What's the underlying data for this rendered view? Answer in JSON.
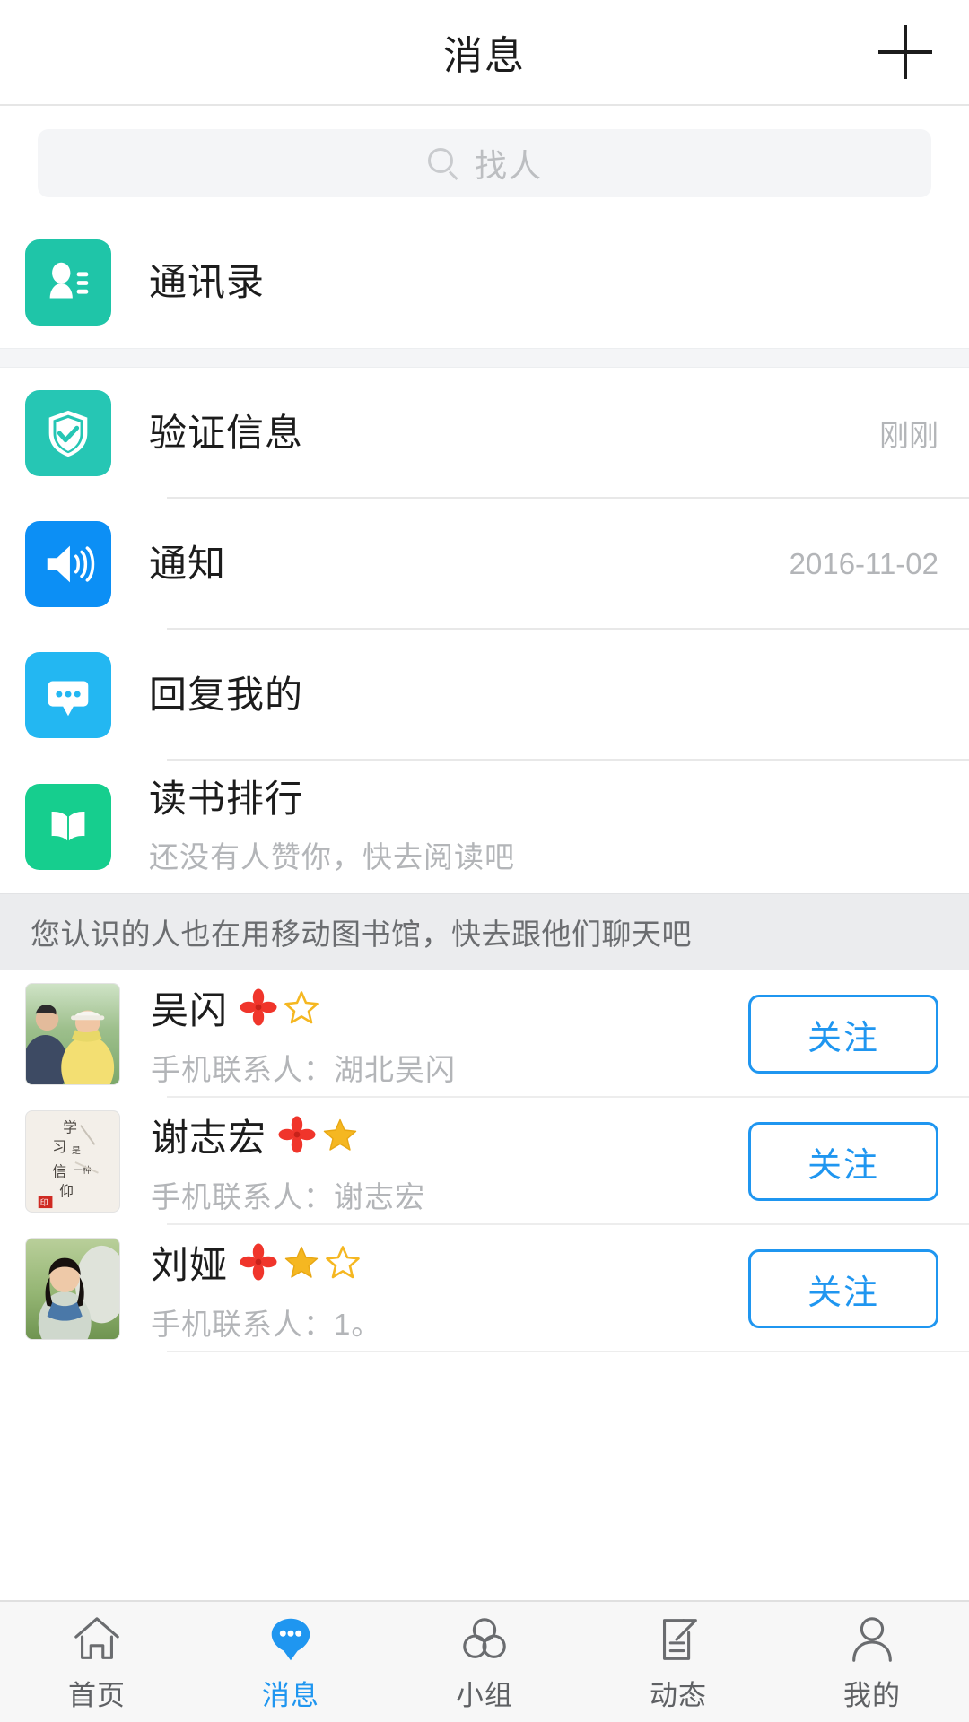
{
  "header": {
    "title": "消息",
    "add_button_label": "+"
  },
  "search": {
    "placeholder": "找人",
    "value": "",
    "icon": "search-icon"
  },
  "contacts_entry": {
    "label": "通讯录",
    "icon": "address-book-icon",
    "color": "#1FC5A8"
  },
  "message_rows": [
    {
      "label": "验证信息",
      "subtitle": "",
      "time": "刚刚",
      "icon": "shield-check-icon",
      "color": "#26C6B4"
    },
    {
      "label": "通知",
      "subtitle": "",
      "time": "2016-11-02",
      "icon": "speaker-icon",
      "color": "#0C8FF5"
    },
    {
      "label": "回复我的",
      "subtitle": "",
      "time": "",
      "icon": "comment-bubble-icon",
      "color": "#23B7F2"
    },
    {
      "label": "读书排行",
      "subtitle": "还没有人赞你，快去阅读吧",
      "time": "",
      "icon": "open-book-icon",
      "color": "#16CE8E"
    }
  ],
  "banner": {
    "text": "您认识的人也在用移动图书馆，快去跟他们聊天吧"
  },
  "people": [
    {
      "name": "吴闪",
      "subtitle": "手机联系人：湖北吴闪",
      "follow_label": "关注",
      "flower_badge": true,
      "stars_filled": 0,
      "stars_outline": 1,
      "avatar": "couple-photo"
    },
    {
      "name": "谢志宏",
      "subtitle": "手机联系人：谢志宏",
      "follow_label": "关注",
      "flower_badge": true,
      "stars_filled": 1,
      "stars_outline": 0,
      "avatar": "calligraphy-photo"
    },
    {
      "name": "刘娅",
      "subtitle": "手机联系人：1。",
      "follow_label": "关注",
      "flower_badge": true,
      "stars_filled": 1,
      "stars_outline": 1,
      "avatar": "woman-photo"
    }
  ],
  "tabs": [
    {
      "label": "首页",
      "icon": "home-icon",
      "active": false
    },
    {
      "label": "消息",
      "icon": "message-bubble-icon",
      "active": true
    },
    {
      "label": "小组",
      "icon": "group-circles-icon",
      "active": false
    },
    {
      "label": "动态",
      "icon": "edit-note-icon",
      "active": false
    },
    {
      "label": "我的",
      "icon": "person-icon",
      "active": false
    }
  ],
  "colors": {
    "accent_blue": "#1F96F0",
    "teal": "#1FC5A8",
    "green": "#16CE8E",
    "muted_text": "#B3B5B8",
    "banner_bg": "#EBECEE",
    "star_gold": "#F5B721",
    "flower_red": "#F0352B"
  }
}
